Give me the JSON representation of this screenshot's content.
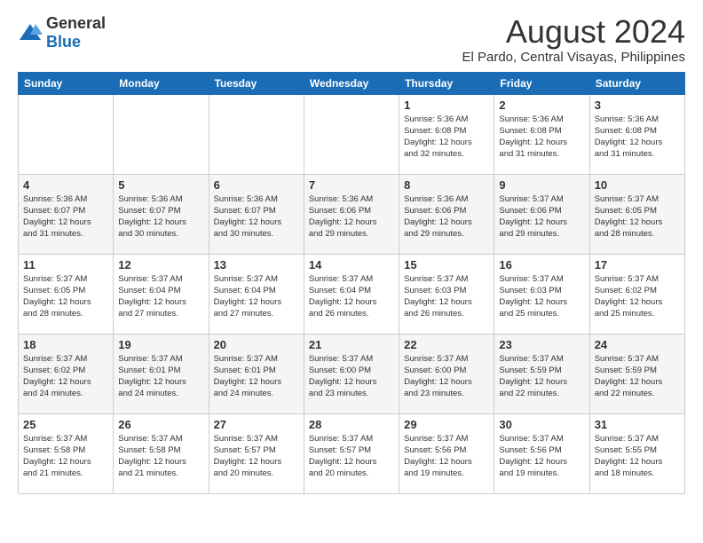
{
  "header": {
    "logo_general": "General",
    "logo_blue": "Blue",
    "title": "August 2024",
    "subtitle": "El Pardo, Central Visayas, Philippines"
  },
  "weekdays": [
    "Sunday",
    "Monday",
    "Tuesday",
    "Wednesday",
    "Thursday",
    "Friday",
    "Saturday"
  ],
  "weeks": [
    [
      {
        "date": "",
        "info": ""
      },
      {
        "date": "",
        "info": ""
      },
      {
        "date": "",
        "info": ""
      },
      {
        "date": "",
        "info": ""
      },
      {
        "date": "1",
        "info": "Sunrise: 5:36 AM\nSunset: 6:08 PM\nDaylight: 12 hours\nand 32 minutes."
      },
      {
        "date": "2",
        "info": "Sunrise: 5:36 AM\nSunset: 6:08 PM\nDaylight: 12 hours\nand 31 minutes."
      },
      {
        "date": "3",
        "info": "Sunrise: 5:36 AM\nSunset: 6:08 PM\nDaylight: 12 hours\nand 31 minutes."
      }
    ],
    [
      {
        "date": "4",
        "info": "Sunrise: 5:36 AM\nSunset: 6:07 PM\nDaylight: 12 hours\nand 31 minutes."
      },
      {
        "date": "5",
        "info": "Sunrise: 5:36 AM\nSunset: 6:07 PM\nDaylight: 12 hours\nand 30 minutes."
      },
      {
        "date": "6",
        "info": "Sunrise: 5:36 AM\nSunset: 6:07 PM\nDaylight: 12 hours\nand 30 minutes."
      },
      {
        "date": "7",
        "info": "Sunrise: 5:36 AM\nSunset: 6:06 PM\nDaylight: 12 hours\nand 29 minutes."
      },
      {
        "date": "8",
        "info": "Sunrise: 5:36 AM\nSunset: 6:06 PM\nDaylight: 12 hours\nand 29 minutes."
      },
      {
        "date": "9",
        "info": "Sunrise: 5:37 AM\nSunset: 6:06 PM\nDaylight: 12 hours\nand 29 minutes."
      },
      {
        "date": "10",
        "info": "Sunrise: 5:37 AM\nSunset: 6:05 PM\nDaylight: 12 hours\nand 28 minutes."
      }
    ],
    [
      {
        "date": "11",
        "info": "Sunrise: 5:37 AM\nSunset: 6:05 PM\nDaylight: 12 hours\nand 28 minutes."
      },
      {
        "date": "12",
        "info": "Sunrise: 5:37 AM\nSunset: 6:04 PM\nDaylight: 12 hours\nand 27 minutes."
      },
      {
        "date": "13",
        "info": "Sunrise: 5:37 AM\nSunset: 6:04 PM\nDaylight: 12 hours\nand 27 minutes."
      },
      {
        "date": "14",
        "info": "Sunrise: 5:37 AM\nSunset: 6:04 PM\nDaylight: 12 hours\nand 26 minutes."
      },
      {
        "date": "15",
        "info": "Sunrise: 5:37 AM\nSunset: 6:03 PM\nDaylight: 12 hours\nand 26 minutes."
      },
      {
        "date": "16",
        "info": "Sunrise: 5:37 AM\nSunset: 6:03 PM\nDaylight: 12 hours\nand 25 minutes."
      },
      {
        "date": "17",
        "info": "Sunrise: 5:37 AM\nSunset: 6:02 PM\nDaylight: 12 hours\nand 25 minutes."
      }
    ],
    [
      {
        "date": "18",
        "info": "Sunrise: 5:37 AM\nSunset: 6:02 PM\nDaylight: 12 hours\nand 24 minutes."
      },
      {
        "date": "19",
        "info": "Sunrise: 5:37 AM\nSunset: 6:01 PM\nDaylight: 12 hours\nand 24 minutes."
      },
      {
        "date": "20",
        "info": "Sunrise: 5:37 AM\nSunset: 6:01 PM\nDaylight: 12 hours\nand 24 minutes."
      },
      {
        "date": "21",
        "info": "Sunrise: 5:37 AM\nSunset: 6:00 PM\nDaylight: 12 hours\nand 23 minutes."
      },
      {
        "date": "22",
        "info": "Sunrise: 5:37 AM\nSunset: 6:00 PM\nDaylight: 12 hours\nand 23 minutes."
      },
      {
        "date": "23",
        "info": "Sunrise: 5:37 AM\nSunset: 5:59 PM\nDaylight: 12 hours\nand 22 minutes."
      },
      {
        "date": "24",
        "info": "Sunrise: 5:37 AM\nSunset: 5:59 PM\nDaylight: 12 hours\nand 22 minutes."
      }
    ],
    [
      {
        "date": "25",
        "info": "Sunrise: 5:37 AM\nSunset: 5:58 PM\nDaylight: 12 hours\nand 21 minutes."
      },
      {
        "date": "26",
        "info": "Sunrise: 5:37 AM\nSunset: 5:58 PM\nDaylight: 12 hours\nand 21 minutes."
      },
      {
        "date": "27",
        "info": "Sunrise: 5:37 AM\nSunset: 5:57 PM\nDaylight: 12 hours\nand 20 minutes."
      },
      {
        "date": "28",
        "info": "Sunrise: 5:37 AM\nSunset: 5:57 PM\nDaylight: 12 hours\nand 20 minutes."
      },
      {
        "date": "29",
        "info": "Sunrise: 5:37 AM\nSunset: 5:56 PM\nDaylight: 12 hours\nand 19 minutes."
      },
      {
        "date": "30",
        "info": "Sunrise: 5:37 AM\nSunset: 5:56 PM\nDaylight: 12 hours\nand 19 minutes."
      },
      {
        "date": "31",
        "info": "Sunrise: 5:37 AM\nSunset: 5:55 PM\nDaylight: 12 hours\nand 18 minutes."
      }
    ]
  ]
}
